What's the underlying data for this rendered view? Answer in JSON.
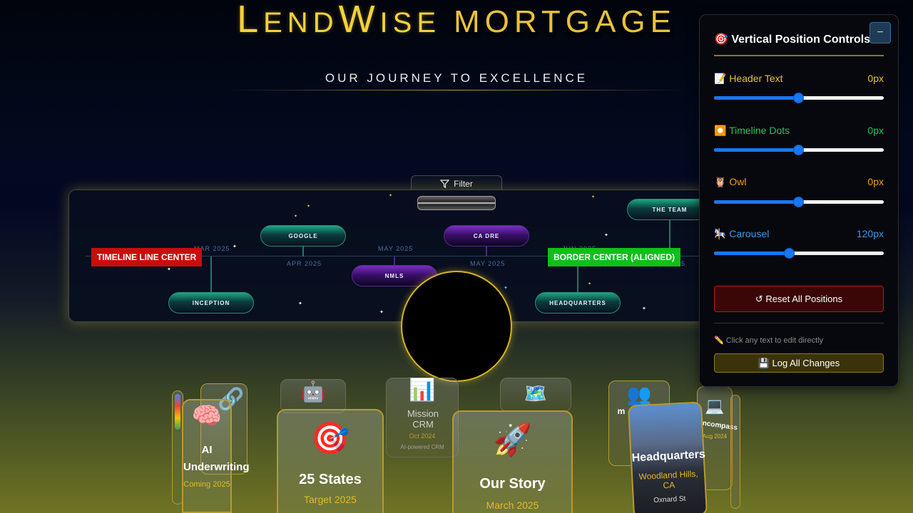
{
  "brand": {
    "first": "L",
    "rest1": "END",
    "w": "W",
    "rest2": "ISE",
    "second": "MORTGAGE"
  },
  "subtitle": "OUR JOURNEY TO EXCELLENCE",
  "filter": {
    "label": "Filter"
  },
  "timeline": {
    "badge_left": "TIMELINE LINE CENTER",
    "badge_right": "BORDER CENTER (ALIGNED)",
    "items": [
      {
        "label": "INCEPTION",
        "date": "MAR 2025",
        "variant": "green"
      },
      {
        "label": "GOOGLE",
        "date": "APR 2025",
        "variant": "green"
      },
      {
        "label": "NMLS",
        "date": "MAY 2025",
        "variant": "purple"
      },
      {
        "label": "CA DRE",
        "date": "MAY 2025",
        "variant": "purple"
      },
      {
        "label": "HEADQUARTERS",
        "date": "JUN 2025",
        "variant": "green"
      },
      {
        "label": "THE TEAM",
        "date": "5",
        "variant": "green"
      }
    ]
  },
  "carousel": {
    "front": [
      {
        "icon": "🎯",
        "title": "25 States",
        "subtitle": "Target 2025"
      },
      {
        "icon": "🚀",
        "title": "Our Story",
        "subtitle": "March 2025"
      }
    ],
    "left": {
      "icon": "🧠",
      "title": "AI Underwriting",
      "subtitle": "Coming 2025"
    },
    "right": {
      "title": "Headquarters",
      "subtitle": "Woodland Hills, CA",
      "extra": "Oxnard St"
    },
    "back": [
      {
        "icon": "🤖",
        "title": ""
      },
      {
        "icon": "📊",
        "title": "Mission CRM",
        "subtitle": "Oct 2024",
        "desc": "AI-powered CRM"
      },
      {
        "icon": "🗺️",
        "title": ""
      },
      {
        "icon": "👥",
        "title": "m"
      },
      {
        "icon": "💻",
        "title": "Encompass",
        "subtitle": "Aug 2024"
      }
    ]
  },
  "controls": {
    "title": "🎯 Vertical Position Controls",
    "minimize": "−",
    "rows": [
      {
        "icon": "📝",
        "label": "Header Text",
        "value": "0px",
        "color": "#e8c23a",
        "fill": 0.5
      },
      {
        "icon": "⏺️",
        "label": "Timeline Dots",
        "value": "0px",
        "color": "#22c55e",
        "fill": 0.5
      },
      {
        "icon": "🦉",
        "label": "Owl",
        "value": "0px",
        "color": "#f59e0b",
        "fill": 0.5
      },
      {
        "icon": "🎠",
        "label": "Carousel",
        "value": "120px",
        "color": "#3b9ae8",
        "fill": 0.44
      }
    ],
    "reset": "↺ Reset All Positions",
    "hint": "✏️ Click any text to edit directly",
    "log": "💾 Log All Changes"
  }
}
